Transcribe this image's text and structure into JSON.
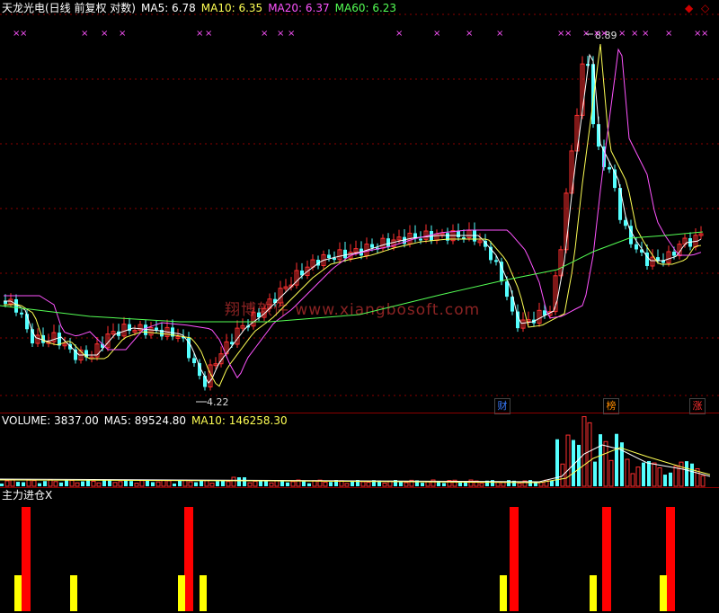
{
  "header": {
    "stock_name": "天龙光电(日线 前复权 对数)",
    "ma5": "MA5: 6.78",
    "ma10": "MA10: 6.35",
    "ma20": "MA20: 6.37",
    "ma60": "MA60: 6.23"
  },
  "volume_header": {
    "volume": "VOLUME: 3837.00",
    "ma5": "MA5: 89524.80",
    "ma10": "MA10: 146258.30"
  },
  "indicator_header": {
    "title": "主力进仓X"
  },
  "annotations": {
    "high_label": "8.89",
    "low_label": "4.22"
  },
  "event_markers": [
    {
      "label": "财",
      "color": "#3a7bff"
    },
    {
      "label": "榜",
      "color": "#ff8c00"
    },
    {
      "label": "涨",
      "color": "#ff3030"
    }
  ],
  "watermark": "翔博软件 www.xiangbosoft.com",
  "colors": {
    "up": "#ff3030",
    "down": "#54ffff",
    "ma5": "#ffffff",
    "ma10": "#ffff54",
    "ma20": "#ff54ff",
    "ma60": "#54ff54",
    "separator": "#8b0000",
    "signal_high": "#ff0000",
    "signal_low": "#ffff00"
  },
  "icons": {
    "close": "diamond-icon",
    "restore": "diamond-outline-icon"
  }
}
